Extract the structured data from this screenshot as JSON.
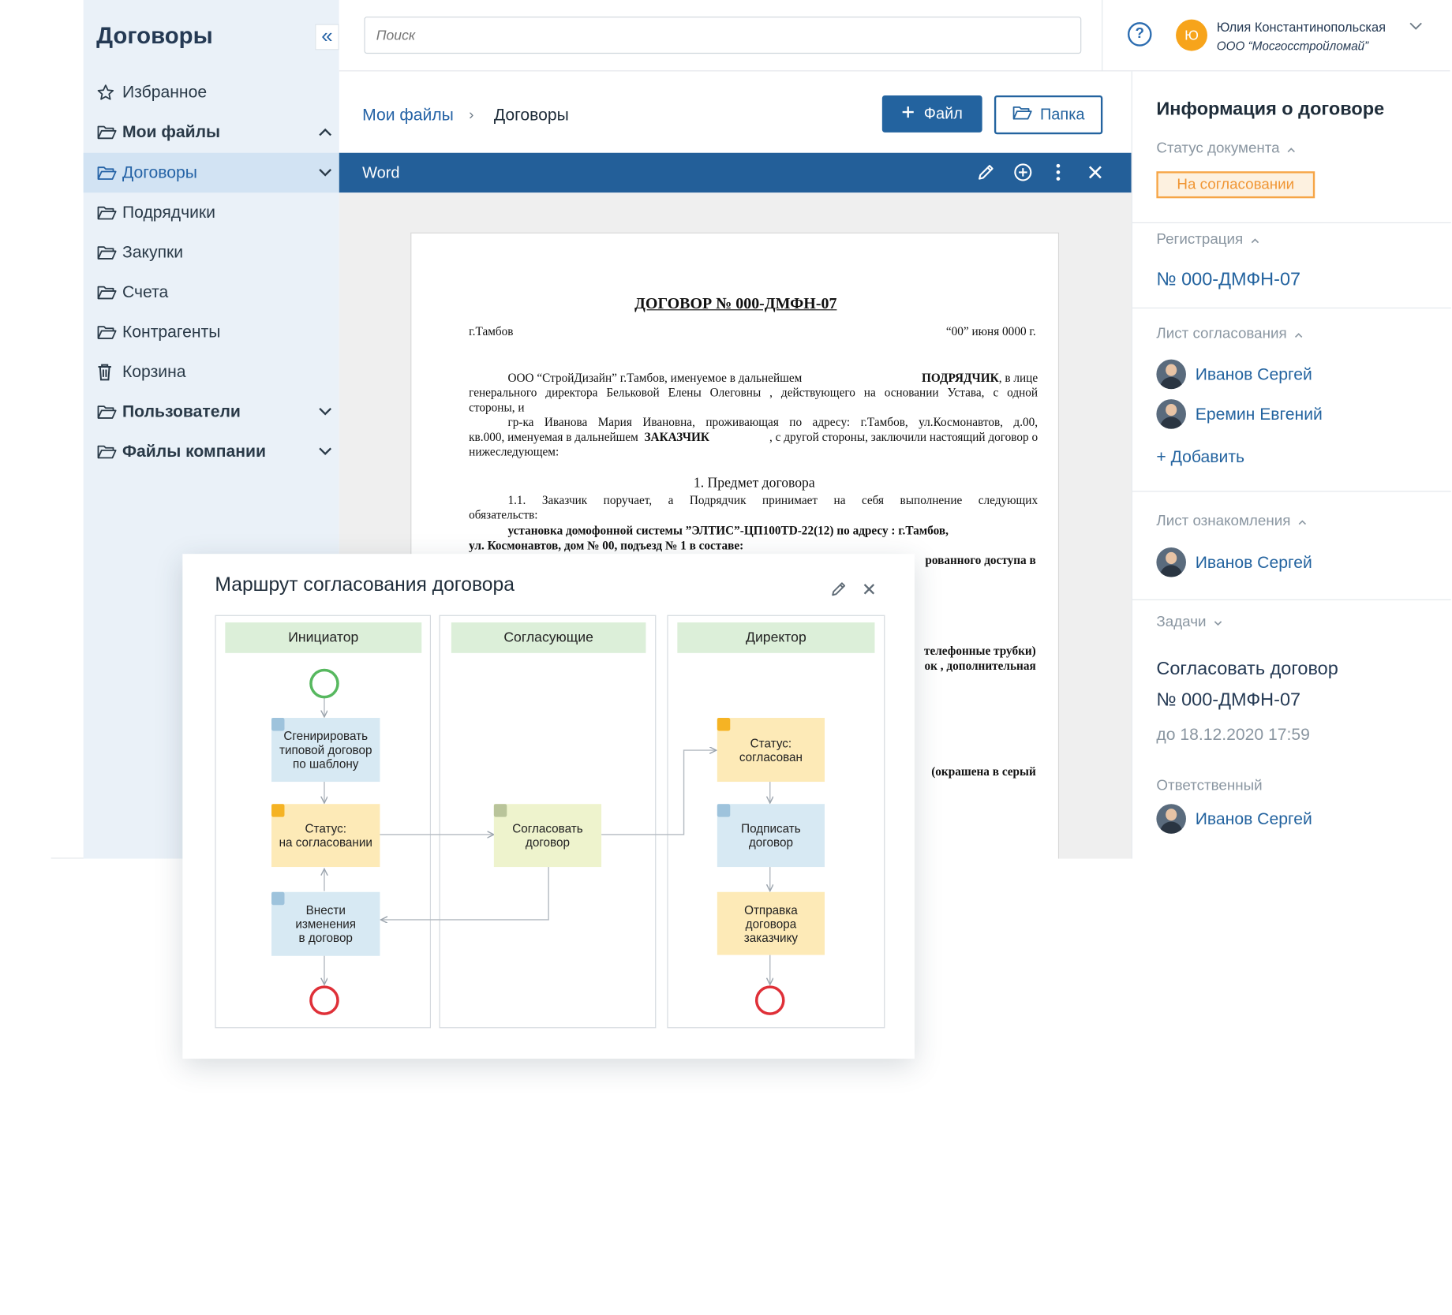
{
  "sidebar": {
    "title": "Договоры",
    "items": [
      {
        "label": "Избранное",
        "icon": "star-icon"
      },
      {
        "label": "Мои файлы",
        "icon": "folder-icon"
      },
      {
        "label": "Договоры",
        "icon": "folder-icon"
      },
      {
        "label": "Подрядчики",
        "icon": "folder-icon"
      },
      {
        "label": "Закупки",
        "icon": "folder-icon"
      },
      {
        "label": "Счета",
        "icon": "folder-icon"
      },
      {
        "label": "Контрагенты",
        "icon": "folder-icon"
      },
      {
        "label": "Корзина",
        "icon": "trash-icon"
      },
      {
        "label": "Пользователи",
        "icon": "folder-icon"
      },
      {
        "label": "Файлы компании",
        "icon": "folder-icon"
      }
    ]
  },
  "header": {
    "search_placeholder": "Поиск",
    "user_initial": "Ю",
    "user_name": "Юлия Константинопольская",
    "user_company": "ООО “Мосгосстройломай”"
  },
  "breadcrumb": {
    "root": "Мои файлы",
    "current": "Договоры"
  },
  "toolbar": {
    "file_label": "Файл",
    "folder_label": "Папка"
  },
  "viewer": {
    "title": "Word"
  },
  "document": {
    "title": "ДОГОВОР № 000-ДМФН-07",
    "city": "г.Тамбов",
    "date": "“00” июня  0000 г.",
    "p1_a": "ООО “СтройДизайн” г.Тамбов, именуемое в дальнейшем",
    "p1_b": "ПОДРЯДЧИК",
    "p1_c": ", в лице",
    "p1_l2": "генерального директора Бельковой Елены Олеговны , действующего на основании Устава, с одной",
    "p1_l3": "стороны, и",
    "p2_l1": "гр-ка Иванова Мария Ивановна, проживающая по адресу: г.Тамбов, ул.Космонавтов, д.00,",
    "p2_l2a": "кв.000, именуемая в дальнейшем",
    "p2_l2b": "ЗАКАЗЧИК",
    "p2_l2c": ", с другой стороны, заключили настоящий договор о",
    "p2_l3": "нижеследующем:",
    "section": "1. Предмет договора",
    "s1_l1": "1.1.  Заказчик  поручает,  а  Подрядчик  принимает  на  себя  выполнение  следующих",
    "s1_l2": "обязательств:",
    "s1_l3": "установка домофонной системы ”ЭЛТИС”-ЦП100TD-22(12) по адресу : г.Тамбов,",
    "s1_l4": "ул. Космонавтов, дом  № 00, подъезд № 1 в составе:",
    "frag1": "рованного доступа в",
    "frag2": "телефонные трубки)",
    "frag3": "ок , дополнительная",
    "frag4": "(окрашена в серый"
  },
  "info": {
    "title": "Информация о договоре",
    "status_header": "Статус документа",
    "status": "На согласовании",
    "reg_header": "Регистрация",
    "reg_number": "№ 000-ДМФН-07",
    "approval_header": "Лист согласования",
    "approvers": [
      "Иванов Сергей",
      "Еремин Евгений"
    ],
    "add_label": "Добавить",
    "ack_header": "Лист ознакомления",
    "ack": [
      "Иванов Сергей"
    ],
    "tasks_header": "Задачи",
    "task_line1": "Согласовать договор",
    "task_line2": "№ 000-ДМФН-07",
    "task_due": "до 18.12.2020  17:59",
    "resp_header": "Ответственный",
    "responsible": "Иванов Сергей"
  },
  "route": {
    "title": "Маршрут согласования договора",
    "lanes": [
      "Инициатор",
      "Согласующие",
      "Директор"
    ],
    "nodes": {
      "generate": [
        "Сгенирировать",
        "типовой договор",
        "по шаблону"
      ],
      "status1": [
        "Статус:",
        "на согласовании"
      ],
      "changes": [
        "Внести",
        "изменения",
        "в договор"
      ],
      "approve": [
        "Согласовать",
        "договор"
      ],
      "status2": [
        "Статус:",
        "согласован"
      ],
      "sign": [
        "Подписать",
        "договор"
      ],
      "send": [
        "Отправка",
        "договора",
        "заказчику"
      ]
    }
  },
  "colors": {
    "accent": "#23639f",
    "status_orange": "#f09533",
    "sidebar_bg": "#eaf1f8"
  }
}
